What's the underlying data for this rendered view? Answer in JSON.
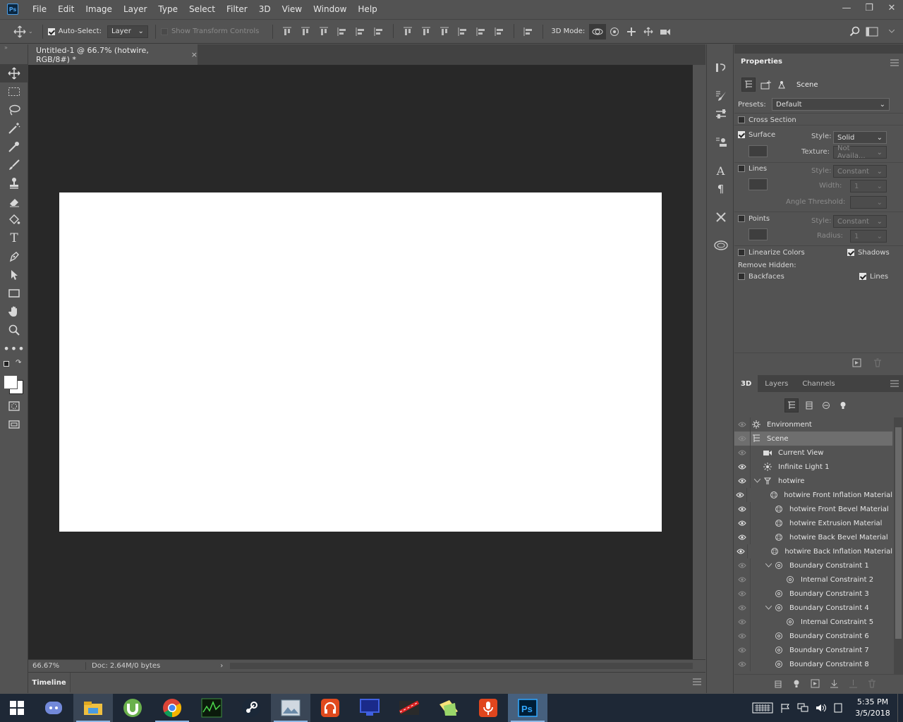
{
  "menu": [
    "File",
    "Edit",
    "Image",
    "Layer",
    "Type",
    "Select",
    "Filter",
    "3D",
    "View",
    "Window",
    "Help"
  ],
  "options": {
    "auto_select_label": "Auto-Select:",
    "auto_select_value": "Layer",
    "show_transform_label": "Show Transform Controls",
    "mode_label": "3D Mode:"
  },
  "document": {
    "tab_title": "Untitled-1 @ 66.7% (hotwire, RGB/8#) *",
    "close": "×",
    "zoom": "66.67%",
    "doc_info": "Doc: 2.64M/0 bytes"
  },
  "timeline": {
    "label": "Timeline"
  },
  "properties": {
    "title": "Properties",
    "header_label": "Scene",
    "presets_label": "Presets:",
    "presets_value": "Default",
    "cross_section": "Cross Section",
    "surface": "Surface",
    "style_label": "Style:",
    "surface_style": "Solid",
    "texture_label": "Texture:",
    "texture_value": "Not Availa...",
    "lines": "Lines",
    "lines_style": "Constant",
    "width_label": "Width:",
    "width_value": "1",
    "angle_label": "Angle Threshold:",
    "points": "Points",
    "points_style": "Constant",
    "radius_label": "Radius:",
    "radius_value": "1",
    "linearize": "Linearize Colors",
    "shadows": "Shadows",
    "remove_hidden": "Remove Hidden:",
    "backfaces": "Backfaces",
    "hidden_lines": "Lines"
  },
  "panel3d": {
    "tabs": [
      "3D",
      "Layers",
      "Channels"
    ],
    "items": [
      {
        "label": "Environment",
        "icon": "environment-icon",
        "level": 0,
        "eye": "dim"
      },
      {
        "label": "Scene",
        "icon": "scene-icon",
        "level": 0,
        "eye": "dim",
        "selected": true
      },
      {
        "label": "Current View",
        "icon": "camera-icon",
        "level": 1,
        "eye": "dim"
      },
      {
        "label": "Infinite Light 1",
        "icon": "light-icon",
        "level": 1,
        "eye": "on"
      },
      {
        "label": "hotwire",
        "icon": "mesh-icon",
        "level": 1,
        "eye": "on",
        "expanded": true
      },
      {
        "label": "hotwire Front Inflation Material",
        "icon": "material-icon",
        "level": 2,
        "eye": "on"
      },
      {
        "label": "hotwire Front Bevel Material",
        "icon": "material-icon",
        "level": 2,
        "eye": "on"
      },
      {
        "label": "hotwire Extrusion Material",
        "icon": "material-icon",
        "level": 2,
        "eye": "on"
      },
      {
        "label": "hotwire Back Bevel Material",
        "icon": "material-icon",
        "level": 2,
        "eye": "on"
      },
      {
        "label": "hotwire Back Inflation Material",
        "icon": "material-icon",
        "level": 2,
        "eye": "on"
      },
      {
        "label": "Boundary Constraint 1",
        "icon": "constraint-icon",
        "level": 2,
        "eye": "dim",
        "expanded": true
      },
      {
        "label": "Internal Constraint 2",
        "icon": "constraint-icon",
        "level": 3,
        "eye": "dim"
      },
      {
        "label": "Boundary Constraint 3",
        "icon": "constraint-icon",
        "level": 2,
        "eye": "dim"
      },
      {
        "label": "Boundary Constraint 4",
        "icon": "constraint-icon",
        "level": 2,
        "eye": "dim",
        "expanded": true
      },
      {
        "label": "Internal Constraint 5",
        "icon": "constraint-icon",
        "level": 3,
        "eye": "dim"
      },
      {
        "label": "Boundary Constraint 6",
        "icon": "constraint-icon",
        "level": 2,
        "eye": "dim"
      },
      {
        "label": "Boundary Constraint 7",
        "icon": "constraint-icon",
        "level": 2,
        "eye": "dim"
      },
      {
        "label": "Boundary Constraint 8",
        "icon": "constraint-icon",
        "level": 2,
        "eye": "dim"
      }
    ]
  },
  "taskbar": {
    "apps": [
      "windows-start-icon",
      "discord-icon",
      "file-explorer-icon",
      "utorrent-icon",
      "chrome-icon",
      "monitor-app-icon",
      "steam-icon",
      "image-viewer-icon",
      "headphones-app-icon",
      "remote-desktop-icon",
      "game-icon",
      "sticky-folder-icon",
      "microphone-app-icon",
      "photoshop-icon"
    ],
    "time": "5:35 PM",
    "date": "3/5/2018"
  },
  "colors": {
    "ps_blue": "#31a8ff",
    "canvas_bg": "#282828",
    "ui_gray": "#535353",
    "taskbar": "#1e2836"
  }
}
